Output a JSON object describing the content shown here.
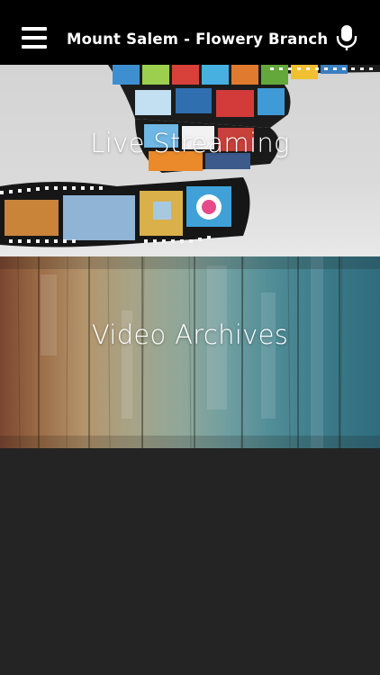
{
  "header": {
    "title": "Mount Salem - Flowery Branch",
    "menu_icon": "hamburger-menu-icon",
    "mic_icon": "microphone-icon"
  },
  "tiles": [
    {
      "label": "Live Streaming"
    },
    {
      "label": "Video Archives"
    }
  ],
  "colors": {
    "app_bar": "#000000",
    "background": "#242424",
    "label": "#ffffff"
  }
}
